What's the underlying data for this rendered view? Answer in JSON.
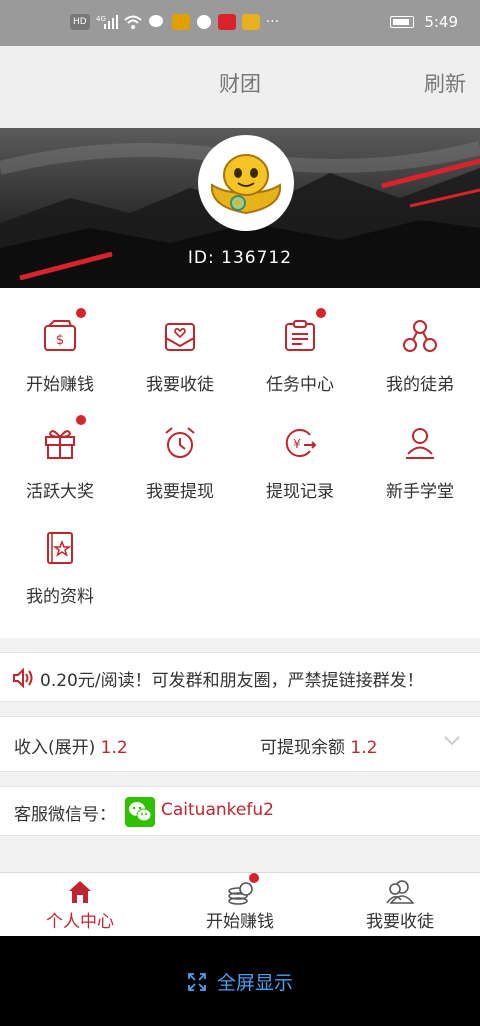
{
  "status_bar": {
    "left_icons": [
      "hd-icon",
      "signal-icon",
      "wifi-icon",
      "app-icon",
      "app-icon",
      "chat-icon",
      "app-icon",
      "app-icon"
    ],
    "chips": [
      "HD",
      "4G"
    ],
    "time": "5:49"
  },
  "header": {
    "title": "财团",
    "refresh_label": "刷新"
  },
  "profile": {
    "id_label": "ID: 136712"
  },
  "menu": {
    "items": [
      {
        "label": "开始赚钱",
        "icon": "wallet-dollar-icon",
        "badge": true
      },
      {
        "label": "我要收徒",
        "icon": "envelope-heart-icon",
        "badge": false
      },
      {
        "label": "任务中心",
        "icon": "clipboard-list-icon",
        "badge": true
      },
      {
        "label": "我的徒弟",
        "icon": "network-circles-icon",
        "badge": false
      },
      {
        "label": "活跃大奖",
        "icon": "gift-icon",
        "badge": true
      },
      {
        "label": "我要提现",
        "icon": "alarm-clock-icon",
        "badge": false
      },
      {
        "label": "提现记录",
        "icon": "yen-arrow-icon",
        "badge": false
      },
      {
        "label": "新手学堂",
        "icon": "user-icon",
        "badge": false
      },
      {
        "label": "我的资料",
        "icon": "book-star-icon",
        "badge": false
      }
    ]
  },
  "notice": {
    "text": "0.20元/阅读！可发群和朋友圈，严禁提链接群发！",
    "icon": "speaker-icon"
  },
  "income": {
    "income_label": "收入(展开)",
    "income_value": "1.2",
    "balance_label": "可提现余额",
    "balance_value": "1.2"
  },
  "support": {
    "label": "客服微信号：",
    "wechat_id": "Caituankefu2"
  },
  "tabs": [
    {
      "label": "个人中心",
      "icon": "home-icon",
      "active": true
    },
    {
      "label": "开始赚钱",
      "icon": "coins-icon",
      "active": false,
      "badge": true
    },
    {
      "label": "我要收徒",
      "icon": "users-icon",
      "active": false
    }
  ],
  "system_nav": {
    "fullscreen_label": "全屏显示"
  },
  "colors": {
    "accent": "#c0262d",
    "badge": "#d8232a",
    "wechat": "#2dc100",
    "nav_text": "#4a9ff5"
  }
}
